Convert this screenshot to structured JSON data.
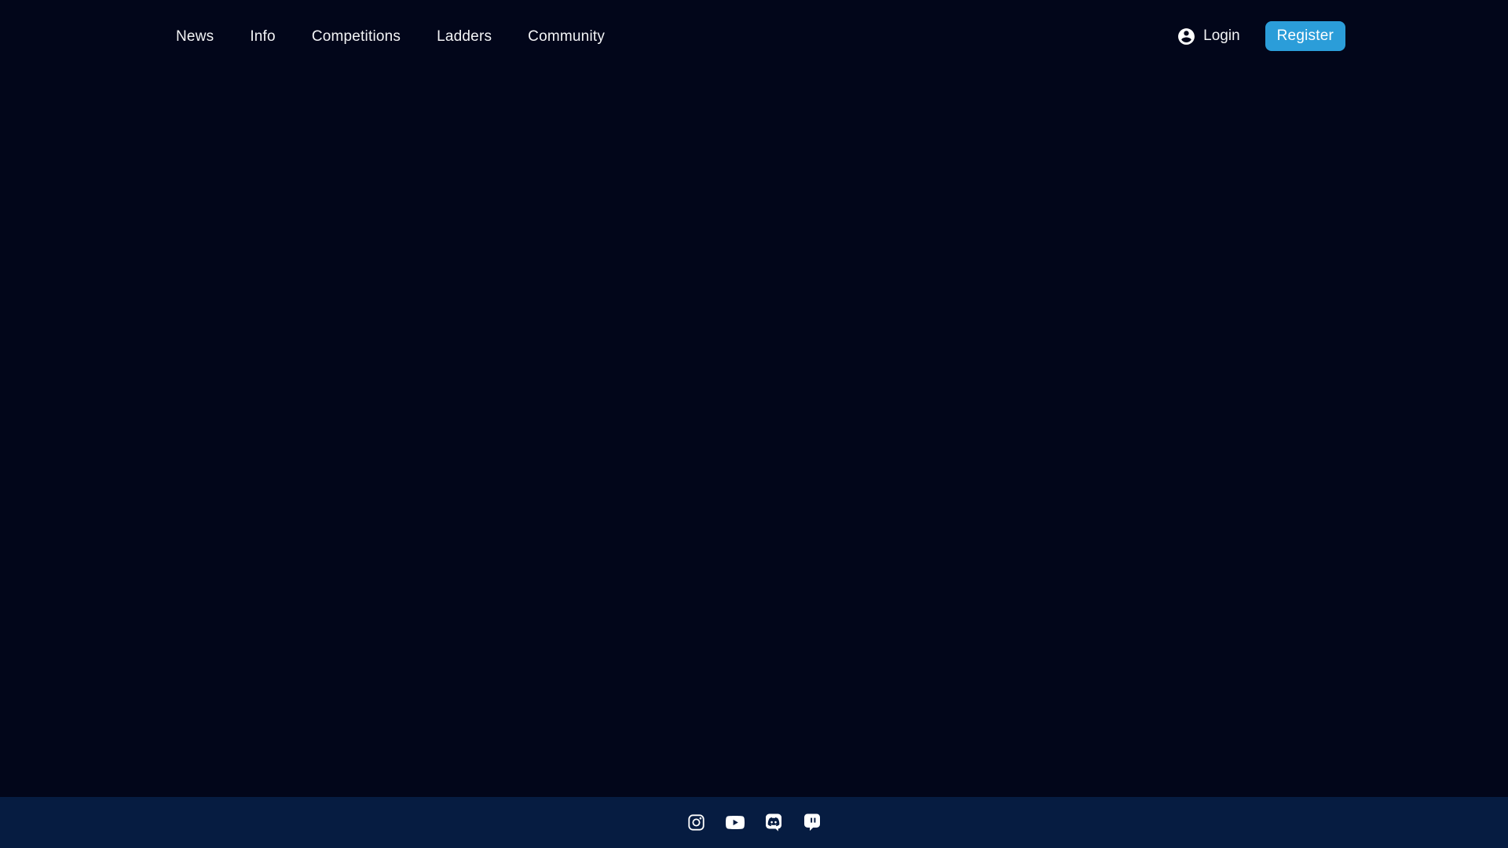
{
  "nav": {
    "items": [
      {
        "label": "News"
      },
      {
        "label": "Info"
      },
      {
        "label": "Competitions"
      },
      {
        "label": "Ladders"
      },
      {
        "label": "Community"
      }
    ]
  },
  "auth": {
    "login_label": "Login",
    "login_icon": "account-circle-icon",
    "register_label": "Register"
  },
  "main": {
    "content": ""
  },
  "footer": {
    "social_icons": [
      {
        "name": "instagram-icon"
      },
      {
        "name": "youtube-icon"
      },
      {
        "name": "discord-icon"
      },
      {
        "name": "twitch-icon"
      }
    ]
  },
  "colors": {
    "background": "#02061a",
    "footer_background": "#061c41",
    "accent": "#2b9dd9",
    "text_primary": "#f3f4f6",
    "icon_white": "#ffffff"
  }
}
